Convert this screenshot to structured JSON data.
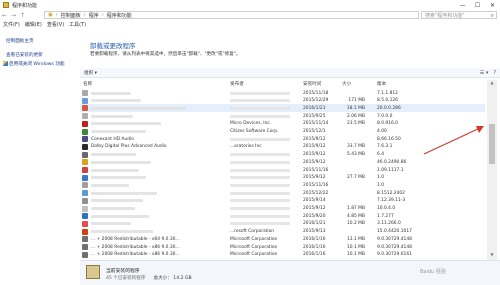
{
  "window": {
    "title": "程序和功能",
    "controls": [
      "—",
      "☐",
      "✕"
    ]
  },
  "address": {
    "path": [
      "控制面板",
      "程序",
      "程序和功能"
    ],
    "search_placeholder": "搜索\"程序和功能\""
  },
  "menu": [
    "文件(F)",
    "编辑(E)",
    "查看(V)",
    "工具(T)"
  ],
  "sidebar": {
    "items": [
      "控制面板主页",
      "查看已安装的更新",
      "启用或关闭 Windows 功能"
    ]
  },
  "main": {
    "title": "卸载或更改程序",
    "description": "若要卸载程序，请从列表中将其选中，然后单击\"卸载\"、\"更改\"或\"修复\"。"
  },
  "toolbar": {
    "organize": "组织 ▾",
    "view_icons": [
      "☰ ▾",
      "?"
    ]
  },
  "columns": {
    "name": "名称",
    "publisher": "发布者",
    "date": "安装时间",
    "size": "大小",
    "version": "版本"
  },
  "rows": [
    {
      "name": "",
      "publisher": "",
      "date": "2015/11/18",
      "size": "",
      "version": "7.1.1.812",
      "color": "#a8a8a8",
      "nameBar": 40
    },
    {
      "name": "",
      "publisher": "",
      "date": "2015/12/29",
      "size": "171 MB",
      "version": "8.5.0.126",
      "color": "#6a9ad8",
      "nameBar": 50
    },
    {
      "name": "",
      "publisher": "",
      "date": "2016/1/21",
      "size": "18.1 MB",
      "version": "20.0.0.286",
      "color": "#d05a3a",
      "nameBar": 95,
      "selected": true
    },
    {
      "name": "",
      "publisher": "",
      "date": "2015/9/25",
      "size": "2.06 MB",
      "version": "7.0.0.0",
      "color": "#b0b0b0",
      "nameBar": 42
    },
    {
      "name": "",
      "publisher": "Micro Devices, Inc.",
      "date": "2015/11/14",
      "size": "23.5 MB",
      "version": "8.0.916.0",
      "color": "#c02020",
      "nameBar": 70
    },
    {
      "name": "",
      "publisher": "Citizes Software Corp.",
      "date": "2015/12/1",
      "size": "",
      "version": "4.00",
      "color": "#3a8a3a",
      "nameBar": 55
    },
    {
      "name": "Conexant HD Audio",
      "publisher": "",
      "date": "2015/9/12",
      "size": "",
      "version": "8.66.16.50",
      "color": "#4a4a8a"
    },
    {
      "name": "Dolby Digital Plus Advanced Audio",
      "publisher": "...oratories Inc",
      "date": "2015/9/12",
      "size": "33.7 MB",
      "version": "7.6.3.1",
      "color": "#2a2a2a"
    },
    {
      "name": "",
      "publisher": "",
      "date": "2015/9/12",
      "size": "5.43 MB",
      "version": "6.4",
      "color": "#6a6a6a",
      "nameBar": 45
    },
    {
      "name": "",
      "publisher": "",
      "date": "2015/9/12",
      "size": "",
      "version": "46.0.2490.86",
      "color": "#e0a020",
      "nameBar": 60
    },
    {
      "name": "",
      "publisher": "",
      "date": "2015/11/16",
      "size": "",
      "version": "1.09.1117.1",
      "color": "#d04040",
      "nameBar": 48
    },
    {
      "name": "",
      "publisher": "",
      "date": "2015/9/12",
      "size": "27.7 MB",
      "version": "1.0",
      "color": "#3a78c8",
      "nameBar": 55
    },
    {
      "name": "",
      "publisher": "",
      "date": "2015/11/16",
      "size": "",
      "version": "1.0",
      "color": "#a0a0a0",
      "nameBar": 38
    },
    {
      "name": "",
      "publisher": "",
      "date": "2015/12/22",
      "size": "",
      "version": "8.1512.2402",
      "color": "#5a9ad0",
      "nameBar": 66
    },
    {
      "name": "",
      "publisher": "",
      "date": "2015/9/14",
      "size": "",
      "version": "7.12.39.11-3",
      "color": "#909090",
      "nameBar": 52
    },
    {
      "name": "",
      "publisher": "",
      "date": "2015/9/12",
      "size": "1.87 MB",
      "version": "10.0.4.0",
      "color": "#c0c0c0",
      "nameBar": 44
    },
    {
      "name": "",
      "publisher": "",
      "date": "2015/9/20",
      "size": "4.85 MB",
      "version": "1.7.277",
      "color": "#3070c0",
      "nameBar": 58
    },
    {
      "name": "",
      "publisher": "",
      "date": "2016/1/21",
      "size": "10.2 MB",
      "version": "3.11.266.0",
      "color": "#e05050",
      "nameBar": 40
    },
    {
      "name": "",
      "publisher": "...rosoft Corporation",
      "date": "2015/9/13",
      "size": "",
      "version": "15.0.4420.1017",
      "color": "#d04010",
      "nameBar": 62
    },
    {
      "name": "... + 2008 Redistributable - x64 9.0.30...",
      "publisher": "Microsoft Corporation",
      "date": "2016/1/16",
      "size": "13.1 MB",
      "version": "9.0.30729.4148",
      "color": "#707070"
    },
    {
      "name": "... + 2008 Redistributable - x86 9.0.30...",
      "publisher": "Microsoft Corporation",
      "date": "2016/1/16",
      "size": "10.1 MB",
      "version": "9.0.30729.4148",
      "color": "#707070"
    },
    {
      "name": "... + 2008 Redistributable - x86 9.0.30...",
      "publisher": "Microsoft Corporation",
      "date": "2016/1/16",
      "size": "10.1 MB",
      "version": "9.0.30729.6161",
      "color": "#707070"
    }
  ],
  "status": {
    "title": "当前安装的程序",
    "count": "45 个已安装的程序",
    "total_size": "总大小：  14.2 GB"
  },
  "watermark": "Baidu 经验",
  "annotation_color": "#d23a2a"
}
